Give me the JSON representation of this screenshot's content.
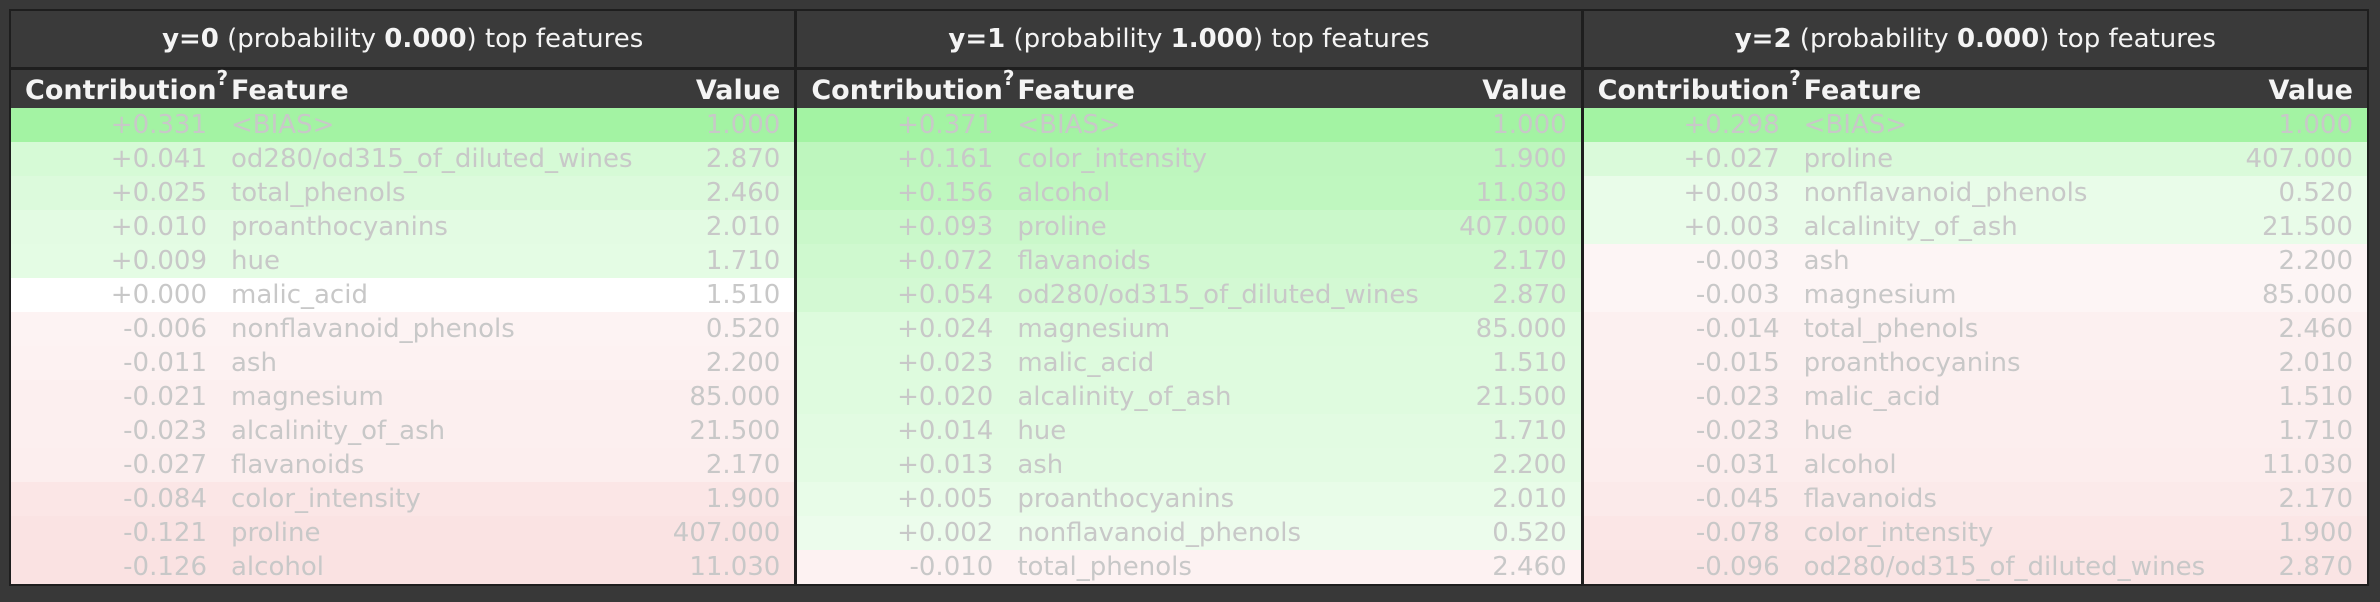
{
  "headers": {
    "contribution": "Contribution",
    "help": "?",
    "feature": "Feature",
    "value": "Value"
  },
  "panels": [
    {
      "label": "y=0",
      "prob_prefix": " (probability ",
      "probability": "0.000",
      "prob_suffix": ") top features",
      "rows": [
        {
          "contribution": "+0.331",
          "feature": "<BIAS>",
          "value": "1.000",
          "weight": 0.331
        },
        {
          "contribution": "+0.041",
          "feature": "od280/od315_of_diluted_wines",
          "value": "2.870",
          "weight": 0.041
        },
        {
          "contribution": "+0.025",
          "feature": "total_phenols",
          "value": "2.460",
          "weight": 0.025
        },
        {
          "contribution": "+0.010",
          "feature": "proanthocyanins",
          "value": "2.010",
          "weight": 0.01
        },
        {
          "contribution": "+0.009",
          "feature": "hue",
          "value": "1.710",
          "weight": 0.009
        },
        {
          "contribution": "+0.000",
          "feature": "malic_acid",
          "value": "1.510",
          "weight": 0.0
        },
        {
          "contribution": "-0.006",
          "feature": "nonflavanoid_phenols",
          "value": "0.520",
          "weight": -0.006
        },
        {
          "contribution": "-0.011",
          "feature": "ash",
          "value": "2.200",
          "weight": -0.011
        },
        {
          "contribution": "-0.021",
          "feature": "magnesium",
          "value": "85.000",
          "weight": -0.021
        },
        {
          "contribution": "-0.023",
          "feature": "alcalinity_of_ash",
          "value": "21.500",
          "weight": -0.023
        },
        {
          "contribution": "-0.027",
          "feature": "flavanoids",
          "value": "2.170",
          "weight": -0.027
        },
        {
          "contribution": "-0.084",
          "feature": "color_intensity",
          "value": "1.900",
          "weight": -0.084
        },
        {
          "contribution": "-0.121",
          "feature": "proline",
          "value": "407.000",
          "weight": -0.121
        },
        {
          "contribution": "-0.126",
          "feature": "alcohol",
          "value": "11.030",
          "weight": -0.126
        }
      ]
    },
    {
      "label": "y=1",
      "prob_prefix": " (probability ",
      "probability": "1.000",
      "prob_suffix": ") top features",
      "rows": [
        {
          "contribution": "+0.371",
          "feature": "<BIAS>",
          "value": "1.000",
          "weight": 0.371
        },
        {
          "contribution": "+0.161",
          "feature": "color_intensity",
          "value": "1.900",
          "weight": 0.161
        },
        {
          "contribution": "+0.156",
          "feature": "alcohol",
          "value": "11.030",
          "weight": 0.156
        },
        {
          "contribution": "+0.093",
          "feature": "proline",
          "value": "407.000",
          "weight": 0.093
        },
        {
          "contribution": "+0.072",
          "feature": "flavanoids",
          "value": "2.170",
          "weight": 0.072
        },
        {
          "contribution": "+0.054",
          "feature": "od280/od315_of_diluted_wines",
          "value": "2.870",
          "weight": 0.054
        },
        {
          "contribution": "+0.024",
          "feature": "magnesium",
          "value": "85.000",
          "weight": 0.024
        },
        {
          "contribution": "+0.023",
          "feature": "malic_acid",
          "value": "1.510",
          "weight": 0.023
        },
        {
          "contribution": "+0.020",
          "feature": "alcalinity_of_ash",
          "value": "21.500",
          "weight": 0.02
        },
        {
          "contribution": "+0.014",
          "feature": "hue",
          "value": "1.710",
          "weight": 0.014
        },
        {
          "contribution": "+0.013",
          "feature": "ash",
          "value": "2.200",
          "weight": 0.013
        },
        {
          "contribution": "+0.005",
          "feature": "proanthocyanins",
          "value": "2.010",
          "weight": 0.005
        },
        {
          "contribution": "+0.002",
          "feature": "nonflavanoid_phenols",
          "value": "0.520",
          "weight": 0.002
        },
        {
          "contribution": "-0.010",
          "feature": "total_phenols",
          "value": "2.460",
          "weight": -0.01
        }
      ]
    },
    {
      "label": "y=2",
      "prob_prefix": " (probability ",
      "probability": "0.000",
      "prob_suffix": ") top features",
      "rows": [
        {
          "contribution": "+0.298",
          "feature": "<BIAS>",
          "value": "1.000",
          "weight": 0.298
        },
        {
          "contribution": "+0.027",
          "feature": "proline",
          "value": "407.000",
          "weight": 0.027
        },
        {
          "contribution": "+0.003",
          "feature": "nonflavanoid_phenols",
          "value": "0.520",
          "weight": 0.003
        },
        {
          "contribution": "+0.003",
          "feature": "alcalinity_of_ash",
          "value": "21.500",
          "weight": 0.003
        },
        {
          "contribution": "-0.003",
          "feature": "ash",
          "value": "2.200",
          "weight": -0.003
        },
        {
          "contribution": "-0.003",
          "feature": "magnesium",
          "value": "85.000",
          "weight": -0.003
        },
        {
          "contribution": "-0.014",
          "feature": "total_phenols",
          "value": "2.460",
          "weight": -0.014
        },
        {
          "contribution": "-0.015",
          "feature": "proanthocyanins",
          "value": "2.010",
          "weight": -0.015
        },
        {
          "contribution": "-0.023",
          "feature": "malic_acid",
          "value": "1.510",
          "weight": -0.023
        },
        {
          "contribution": "-0.023",
          "feature": "hue",
          "value": "1.710",
          "weight": -0.023
        },
        {
          "contribution": "-0.031",
          "feature": "alcohol",
          "value": "11.030",
          "weight": -0.031
        },
        {
          "contribution": "-0.045",
          "feature": "flavanoids",
          "value": "2.170",
          "weight": -0.045
        },
        {
          "contribution": "-0.078",
          "feature": "color_intensity",
          "value": "1.900",
          "weight": -0.078
        },
        {
          "contribution": "-0.096",
          "feature": "od280/od315_of_diluted_wines",
          "value": "2.870",
          "weight": -0.096
        }
      ]
    }
  ],
  "colors": {
    "positive": "#9ef59e",
    "negative": "#f5c2c2",
    "text": "#c8c8c8",
    "header_bg": "#3a3a3a"
  }
}
